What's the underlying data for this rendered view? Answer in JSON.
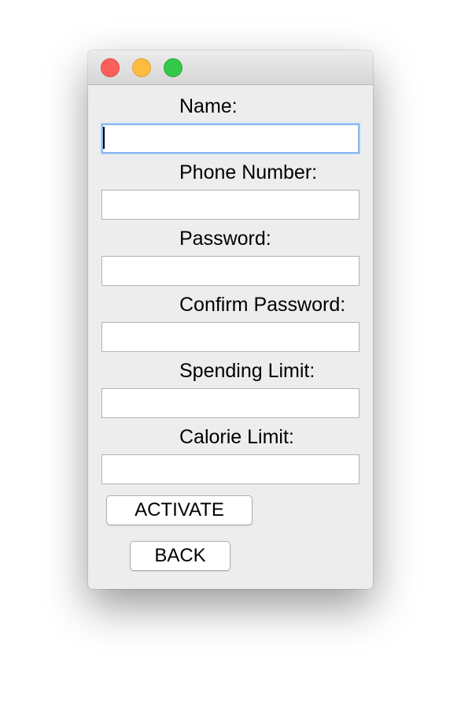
{
  "form": {
    "fields": [
      {
        "label": "Name:",
        "value": ""
      },
      {
        "label": "Phone Number:",
        "value": ""
      },
      {
        "label": "Password:",
        "value": ""
      },
      {
        "label": "Confirm Password:",
        "value": ""
      },
      {
        "label": "Spending Limit:",
        "value": ""
      },
      {
        "label": "Calorie Limit:",
        "value": ""
      }
    ],
    "focused_field": "Name:"
  },
  "buttons": {
    "activate_label": "ACTIVATE",
    "back_label": "BACK"
  },
  "colors": {
    "window_bg": "#ededed",
    "close_light": "#fc605b",
    "minimize_light": "#fdbc40",
    "zoom_light": "#34c84a",
    "focus_ring": "#8ab8f0"
  }
}
